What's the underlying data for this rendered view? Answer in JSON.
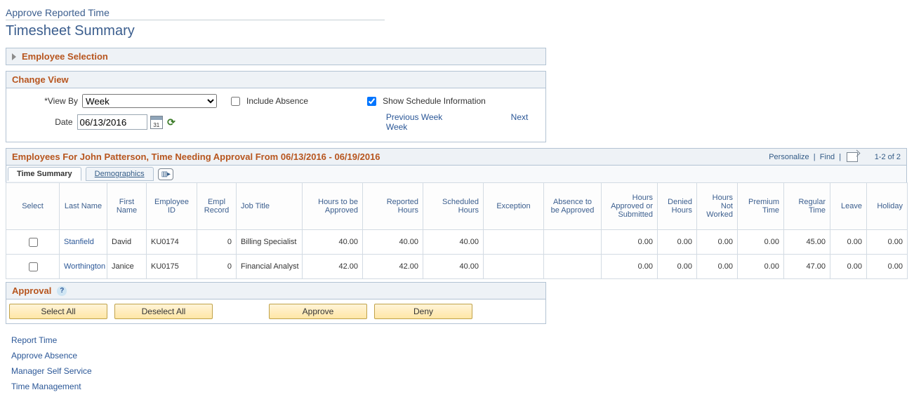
{
  "pageTitle": "Approve Reported Time",
  "subTitle": "Timesheet Summary",
  "employeeSelection": {
    "title": "Employee Selection"
  },
  "changeView": {
    "title": "Change View",
    "viewByLabel": "View By",
    "viewByValue": "Week",
    "includeAbsence": "Include Absence",
    "showSchedule": "Show Schedule Information",
    "dateLabel": "Date",
    "dateValue": "06/13/2016",
    "prevWeek": "Previous Week",
    "nextWeek": "Next Week"
  },
  "grid": {
    "title": "Employees For John Patterson, Time Needing Approval From 06/13/2016 - 06/19/2016",
    "personalize": "Personalize",
    "find": "Find",
    "pageRange": "1-2 of 2",
    "tabs": {
      "timeSummary": "Time Summary",
      "demographics": "Demographics"
    },
    "columns": {
      "select": "Select",
      "lastName": "Last Name",
      "firstName": "First Name",
      "employeeId": "Employee ID",
      "emplRecord": "Empl Record",
      "jobTitle": "Job Title",
      "hoursToApprove": "Hours to be Approved",
      "reportedHours": "Reported Hours",
      "scheduledHours": "Scheduled Hours",
      "exception": "Exception",
      "absenceToApprove": "Absence to be Approved",
      "hoursApprovedSubmitted": "Hours Approved or Submitted",
      "deniedHours": "Denied Hours",
      "hoursNotWorked": "Hours Not Worked",
      "premiumTime": "Premium Time",
      "regularTime": "Regular Time",
      "leave": "Leave",
      "holiday": "Holiday"
    },
    "rows": [
      {
        "lastName": "Stanfield",
        "firstName": "David",
        "employeeId": "KU0174",
        "emplRecord": "0",
        "jobTitle": "Billing Specialist",
        "hoursToApprove": "40.00",
        "reportedHours": "40.00",
        "scheduledHours": "40.00",
        "exception": "",
        "absenceToApprove": "",
        "hoursApprovedSubmitted": "0.00",
        "deniedHours": "0.00",
        "hoursNotWorked": "0.00",
        "premiumTime": "0.00",
        "regularTime": "45.00",
        "leave": "0.00",
        "holiday": "0.00"
      },
      {
        "lastName": "Worthington",
        "firstName": "Janice",
        "employeeId": "KU0175",
        "emplRecord": "0",
        "jobTitle": "Financial Analyst",
        "hoursToApprove": "42.00",
        "reportedHours": "42.00",
        "scheduledHours": "40.00",
        "exception": "",
        "absenceToApprove": "",
        "hoursApprovedSubmitted": "0.00",
        "deniedHours": "0.00",
        "hoursNotWorked": "0.00",
        "premiumTime": "0.00",
        "regularTime": "47.00",
        "leave": "0.00",
        "holiday": "0.00"
      }
    ]
  },
  "approval": {
    "title": "Approval",
    "selectAll": "Select All",
    "deselectAll": "Deselect All",
    "approve": "Approve",
    "deny": "Deny"
  },
  "footerLinks": {
    "reportTime": "Report Time",
    "approveAbsence": "Approve Absence",
    "mss": "Manager Self Service",
    "timeMgmt": "Time Management"
  }
}
